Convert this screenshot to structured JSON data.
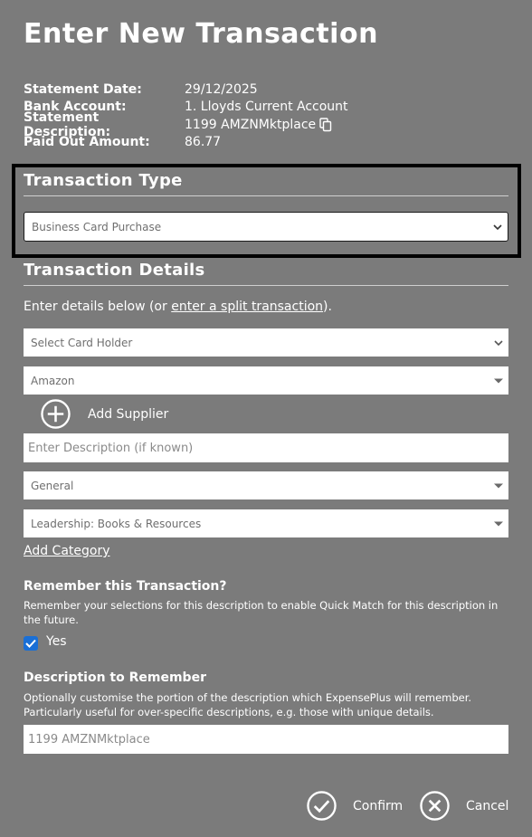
{
  "page": {
    "title": "Enter New Transaction"
  },
  "statement": {
    "items": [
      {
        "label": "Statement Date:",
        "value": "29/12/2025"
      },
      {
        "label": "Bank Account:",
        "value": "1. Lloyds Current Account"
      },
      {
        "label": "Statement Description:",
        "value": "1199 AMZNMktplace"
      },
      {
        "label": "Paid Out Amount:",
        "value": "86.77"
      }
    ]
  },
  "transaction_type": {
    "heading": "Transaction Type",
    "selected": "Business Card Purchase"
  },
  "transaction_details": {
    "heading": "Transaction Details",
    "intro_prefix": "Enter details below (or ",
    "split_link": "enter a split transaction",
    "intro_suffix": ").",
    "card_holder": "Select Card Holder",
    "supplier": "Amazon",
    "add_supplier_label": "Add Supplier",
    "description_placeholder": "Enter Description (if known)",
    "project": "General",
    "category": "Leadership: Books & Resources",
    "add_category_link": "Add Category"
  },
  "remember": {
    "heading": "Remember this Transaction?",
    "help": "Remember your selections for this description to enable Quick Match for this description in the future.",
    "checkbox_label": "Yes",
    "checked": true
  },
  "description_to_remember": {
    "heading": "Description to Remember",
    "help": "Optionally customise the portion of the description which ExpensePlus will remember. Particularly useful for over-specific descriptions, e.g. those with unique details.",
    "value": "1199 AMZNMktplace"
  },
  "footer": {
    "confirm_label": "Confirm",
    "cancel_label": "Cancel"
  },
  "colors": {
    "background": "#7b7b7b",
    "checkbox": "#1a6fd6",
    "highlight_border": "#000000"
  }
}
